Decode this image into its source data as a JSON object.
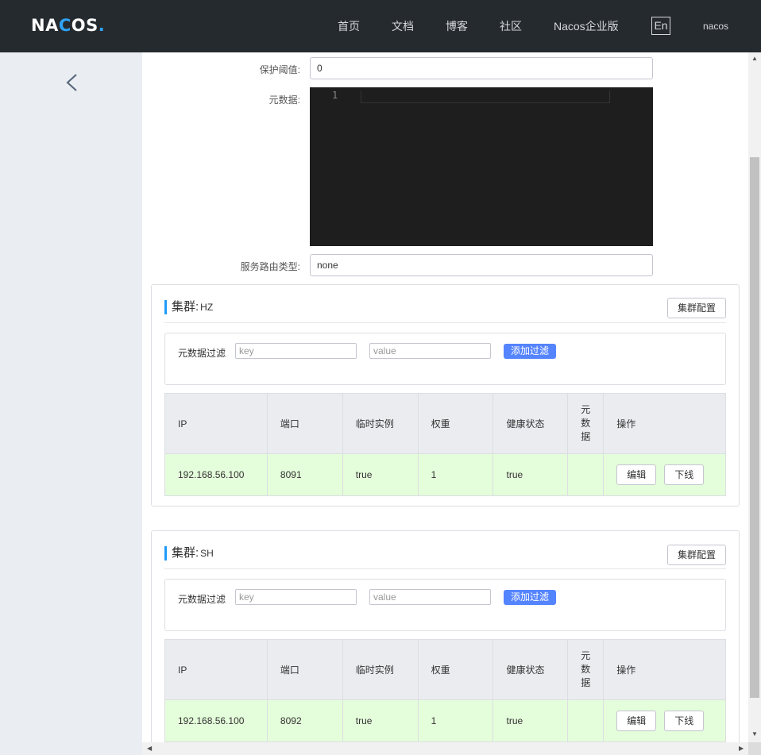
{
  "header": {
    "logo": {
      "part1": "NA",
      "part2": "C",
      "part3": "OS",
      "dot": "."
    },
    "nav": [
      "首页",
      "文档",
      "博客",
      "社区",
      "Nacos企业版"
    ],
    "lang": "En",
    "user": "nacos"
  },
  "sidebar": {
    "back_icon": "chevron-left-icon"
  },
  "form": {
    "threshold_label": "保护阈值:",
    "threshold_value": "0",
    "metadata_label": "元数据:",
    "editor_line": "1",
    "route_label": "服务路由类型:",
    "route_value": "none"
  },
  "clusters": [
    {
      "title": "集群:",
      "name": "HZ",
      "config_button": "集群配置",
      "filter_label": "元数据过滤",
      "key_placeholder": "key",
      "value_placeholder": "value",
      "add_filter": "添加过滤",
      "columns": [
        "IP",
        "端口",
        "临时实例",
        "权重",
        "健康状态",
        "元数据",
        "操作"
      ],
      "meta_col": [
        "元",
        "数",
        "据"
      ],
      "rows": [
        {
          "ip": "192.168.56.100",
          "port": "8091",
          "ephemeral": "true",
          "weight": "1",
          "healthy": "true",
          "metadata": "",
          "edit": "编辑",
          "offline": "下线"
        }
      ]
    },
    {
      "title": "集群:",
      "name": "SH",
      "config_button": "集群配置",
      "filter_label": "元数据过滤",
      "key_placeholder": "key",
      "value_placeholder": "value",
      "add_filter": "添加过滤",
      "columns": [
        "IP",
        "端口",
        "临时实例",
        "权重",
        "健康状态",
        "元数据",
        "操作"
      ],
      "meta_col": [
        "元",
        "数",
        "据"
      ],
      "rows": [
        {
          "ip": "192.168.56.100",
          "port": "8092",
          "ephemeral": "true",
          "weight": "1",
          "healthy": "true",
          "metadata": "",
          "edit": "编辑",
          "offline": "下线"
        }
      ]
    }
  ],
  "colors": {
    "header_bg": "#252a2f",
    "sidebar_bg": "#eaedf1",
    "accent": "#5584ff",
    "row_bg": "#e4fdda",
    "editor_bg": "#1e1e1e"
  }
}
